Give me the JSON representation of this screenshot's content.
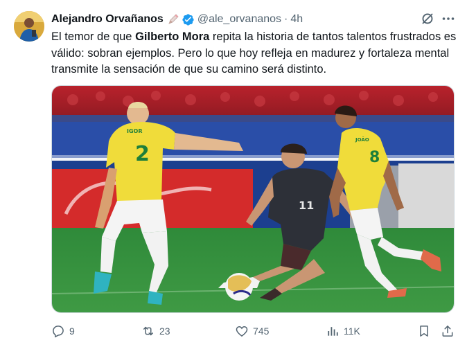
{
  "author": {
    "name": "Alejandro Orvañanos",
    "handle": "@ale_orvananos",
    "separator": "·",
    "time": "4h"
  },
  "text": {
    "part1": "El temor de que ",
    "bold": "Gilberto Mora",
    "part2": " repita la historia de tantos talentos frustrados es válido: sobran ejemplos. Pero lo que hoy refleja en madurez y fortaleza mental transmite la sensación de que su camino será distinto."
  },
  "media": {
    "jersey_names": {
      "player_left": "IGOR",
      "player_right": "JOÃO"
    },
    "jersey_numbers": {
      "player_left": "2",
      "player_right": "8",
      "player_center": "11"
    }
  },
  "actions": {
    "replies": "9",
    "reposts": "23",
    "likes": "745",
    "views": "11K"
  },
  "icons": [
    "avatar",
    "pencil-emoji-icon",
    "verified-badge-icon",
    "grok-icon",
    "more-icon",
    "reply-icon",
    "repost-icon",
    "like-icon",
    "views-icon",
    "bookmark-icon",
    "share-icon"
  ],
  "colors": {
    "text": "#0f1419",
    "secondary": "#536471",
    "verified": "#1d9bf0"
  }
}
